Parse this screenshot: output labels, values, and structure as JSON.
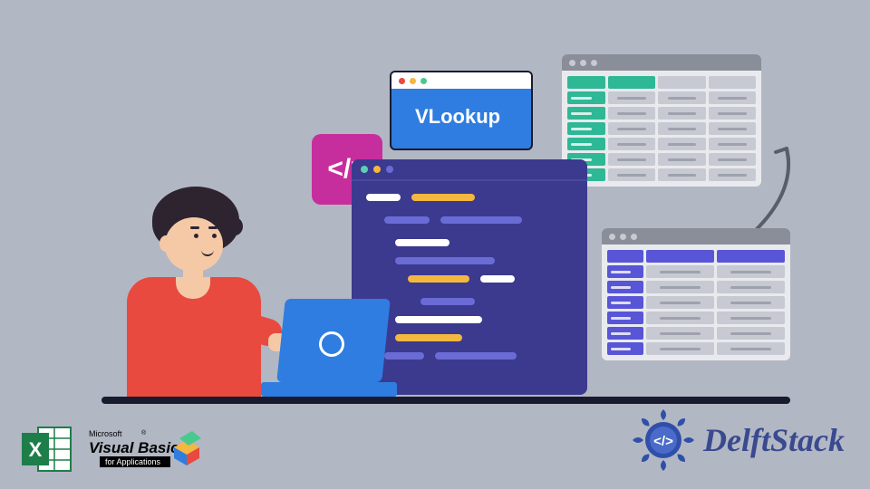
{
  "vlookup": {
    "title": "VLookup"
  },
  "codetag": {
    "symbol": "</>"
  },
  "logos": {
    "vba_top": "Microsoft",
    "vba_main": "Visual Basic",
    "vba_sub": "for Applications",
    "delft": "DelftStack"
  },
  "colors": {
    "bg": "#b2b7c4",
    "editor": "#3b3a8f",
    "vlookup": "#2f7de0",
    "codetag": "#c72e9d",
    "shirt": "#e84a3f",
    "sheet_green": "#2eb896",
    "sheet_purple": "#5856d6"
  }
}
